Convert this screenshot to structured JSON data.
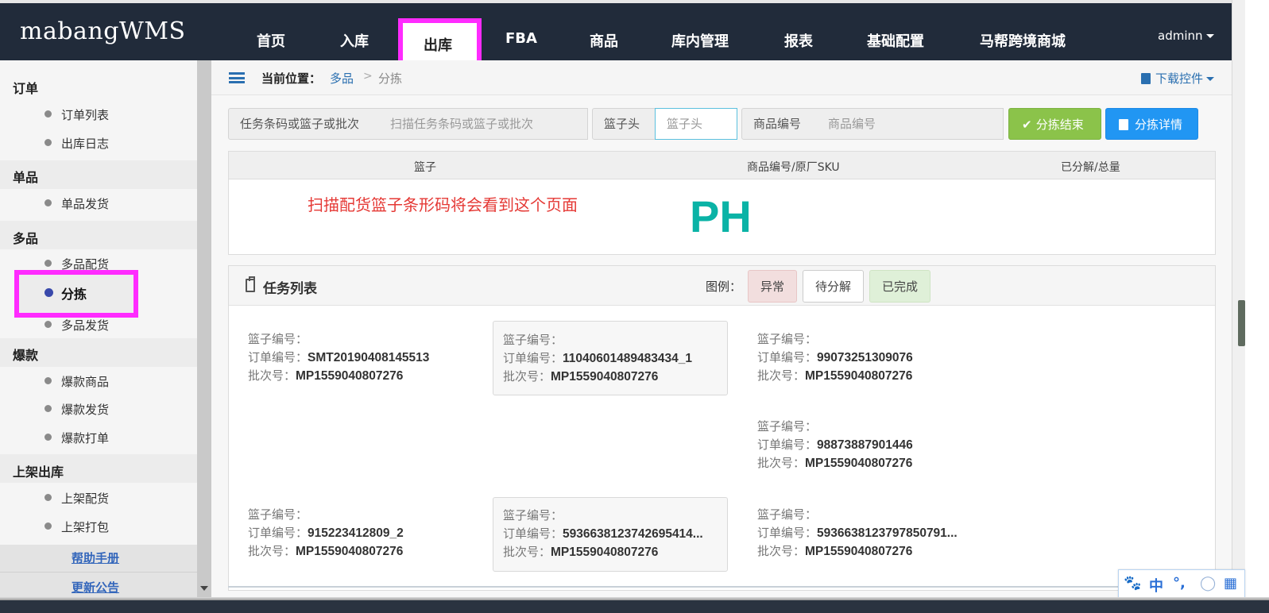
{
  "app": {
    "logo": "mabangWMS",
    "user": "adminn"
  },
  "nav": [
    {
      "label": "首页"
    },
    {
      "label": "入库"
    },
    {
      "label": "出库",
      "active": true
    },
    {
      "label": "FBA"
    },
    {
      "label": "商品"
    },
    {
      "label": "库内管理"
    },
    {
      "label": "报表"
    },
    {
      "label": "基础配置"
    },
    {
      "label": "马帮跨境商城"
    }
  ],
  "sidebar": {
    "groups": [
      {
        "title": "订单",
        "items": [
          "订单列表",
          "出库日志"
        ]
      },
      {
        "title": "单品",
        "items": [
          "单品发货"
        ]
      },
      {
        "title": "多品",
        "items": [
          "多品配货",
          "分拣",
          "多品发货"
        ]
      },
      {
        "title": "爆款",
        "items": [
          "爆款商品",
          "爆款发货",
          "爆款打单"
        ]
      },
      {
        "title": "上架出库",
        "items": [
          "上架配货",
          "上架打包"
        ]
      }
    ],
    "active_item": "分拣",
    "links": [
      "帮助手册",
      "更新公告"
    ]
  },
  "breadcrumb": {
    "label": "当前位置：",
    "parent": "多品",
    "separator": ">",
    "current": "分拣",
    "download": "下载控件"
  },
  "toolbar": {
    "task_label": "任务条码或篮子或批次",
    "task_placeholder": "扫描任务条码或篮子或批次",
    "basket_label": "篮子头",
    "basket_placeholder": "篮子头",
    "sku_label": "商品编号",
    "sku_placeholder": "商品编号",
    "finish_button": "分拣结束",
    "detail_button": "分拣详情"
  },
  "table": {
    "columns": [
      "篮子",
      "商品编号/原厂SKU",
      "已分解/总量"
    ],
    "annotation": "扫描配货篮子条形码将会看到这个页面",
    "watermark": "PH"
  },
  "task_panel": {
    "title": "任务列表",
    "legend_label": "图例：",
    "legend": [
      "异常",
      "待分解",
      "已完成"
    ],
    "field_basket": "篮子编号：",
    "field_order": "订单编号：",
    "field_batch": "批次号：",
    "cards": [
      {
        "basket": "",
        "order": "SMT20190408145513",
        "batch": "MP1559040807276",
        "boxed": false
      },
      {
        "basket": "",
        "order": "11040601489483434_1",
        "batch": "MP1559040807276",
        "boxed": true
      },
      {
        "basket": "",
        "order": "99073251309076",
        "batch": "MP1559040807276",
        "boxed": false
      },
      {
        "basket": "",
        "order": "98873887901446",
        "batch": "MP1559040807276",
        "boxed": false
      },
      {
        "basket": "",
        "order": "915223412809_2",
        "batch": "MP1559040807276",
        "boxed": false
      },
      {
        "basket": "",
        "order": "5936638123742695414...",
        "batch": "MP1559040807276",
        "boxed": true
      },
      {
        "basket": "",
        "order": "5936638123797850791...",
        "batch": "MP1559040807276",
        "boxed": false
      }
    ]
  },
  "ime": {
    "lang": "中",
    "punct": "°,"
  },
  "colors": {
    "topbar": "#212b3a",
    "highlight": "#ff2bff",
    "green": "#8bc34a",
    "blue": "#2196f3",
    "annotation": "#e53935",
    "watermark": "#0ab3a6"
  }
}
